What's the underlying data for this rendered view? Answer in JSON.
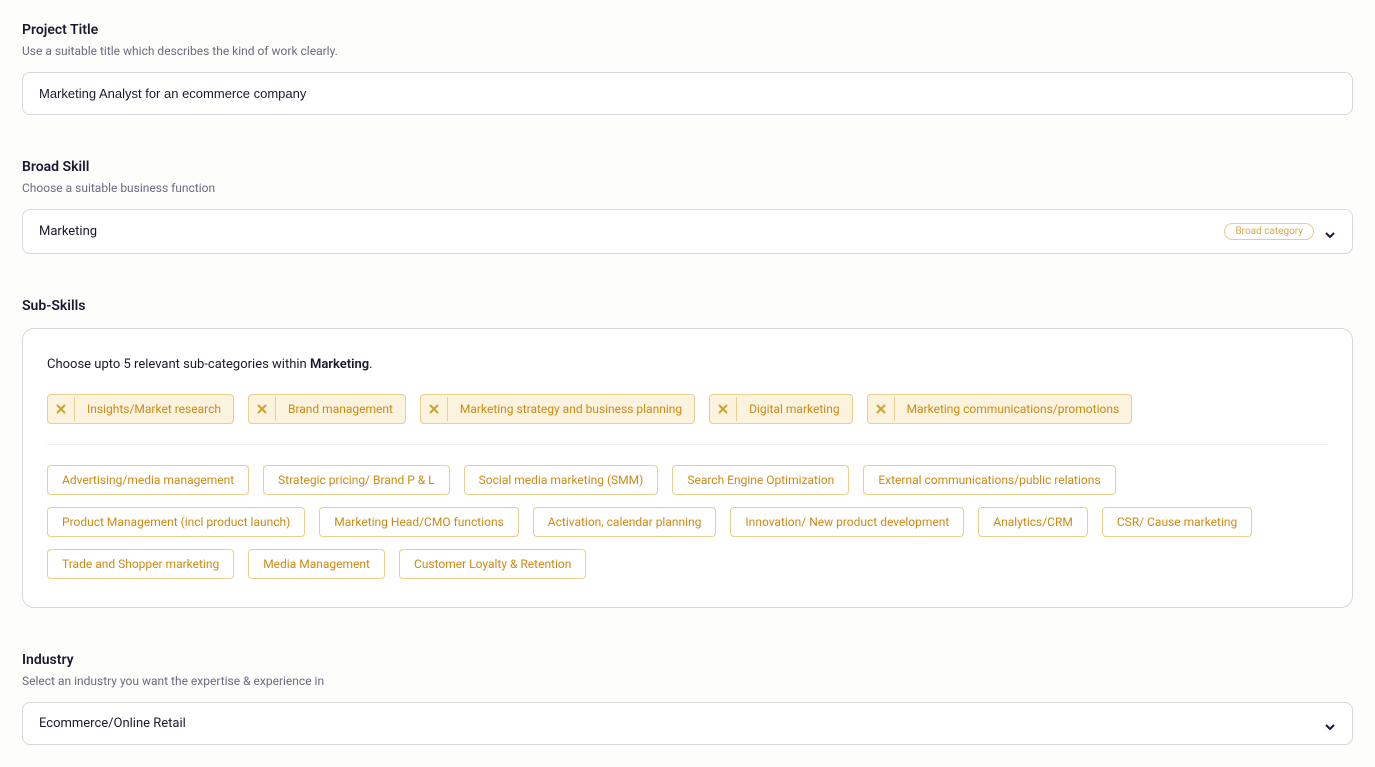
{
  "projectTitle": {
    "label": "Project Title",
    "subtitle": "Use a suitable title which describes the kind of work clearly.",
    "value": "Marketing Analyst for an ecommerce company"
  },
  "broadSkill": {
    "label": "Broad Skill",
    "subtitle": "Choose a suitable business function",
    "value": "Marketing",
    "badge": "Broad category"
  },
  "subSkills": {
    "label": "Sub-Skills",
    "promptPrefix": "Choose upto 5 relevant sub-categories within ",
    "promptStrong": "Marketing",
    "promptSuffix": ".",
    "selected": [
      "Insights/Market research",
      "Brand management",
      "Marketing strategy and business planning",
      "Digital marketing",
      "Marketing communications/promotions"
    ],
    "available": [
      "Advertising/media management",
      "Strategic pricing/ Brand P & L",
      "Social media marketing (SMM)",
      "Search Engine Optimization",
      "External communications/public relations",
      "Product Management (incl product launch)",
      "Marketing Head/CMO functions",
      "Activation, calendar planning",
      "Innovation/ New product development",
      "Analytics/CRM",
      "CSR/ Cause marketing",
      "Trade and Shopper marketing",
      "Media Management",
      "Customer Loyalty & Retention"
    ]
  },
  "industry": {
    "label": "Industry",
    "subtitle": "Select an industry you want the expertise & experience in",
    "value": "Ecommerce/Online Retail"
  }
}
